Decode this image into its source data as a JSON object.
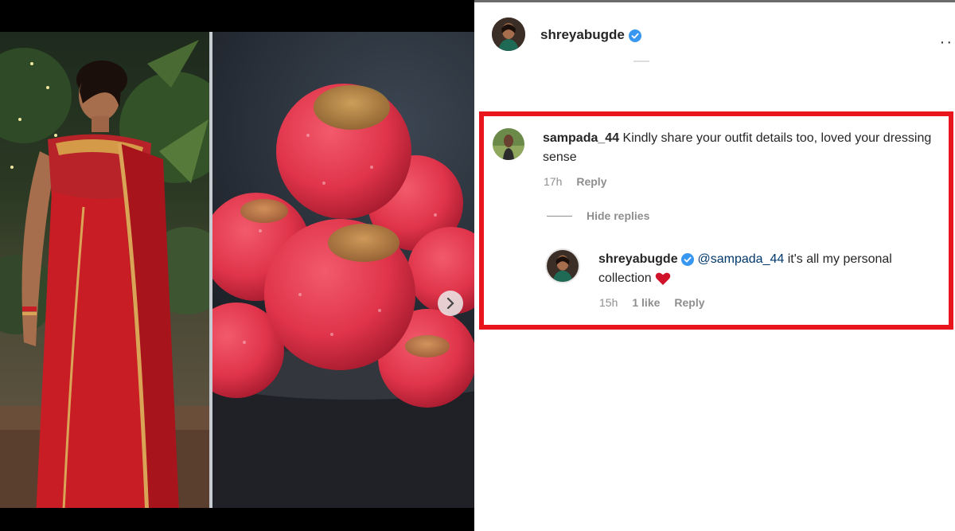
{
  "post": {
    "username": "shreyabugde",
    "verified": true,
    "carousel": {
      "total": 5,
      "active": 0
    }
  },
  "comment": {
    "username": "sampada_44",
    "text": "Kindly share your outfit details too, loved your dressing sense",
    "time": "17h",
    "reply_label": "Reply"
  },
  "hide_replies_label": "Hide replies",
  "reply": {
    "username": "shreyabugde",
    "verified": true,
    "mention": "@sampada_44",
    "text": " it's all my personal collection ",
    "time": "15h",
    "likes": "1 like",
    "reply_label": "Reply"
  },
  "colors": {
    "highlight_border": "#e8161c",
    "verified_badge": "#3897f0",
    "heart": "#d0122a",
    "saree_red": "#c81d25",
    "laddoo_pink": "#e0344a"
  },
  "icons": [
    "verified-badge-icon",
    "more-options-icon",
    "next-arrow-icon",
    "red-heart-icon"
  ]
}
